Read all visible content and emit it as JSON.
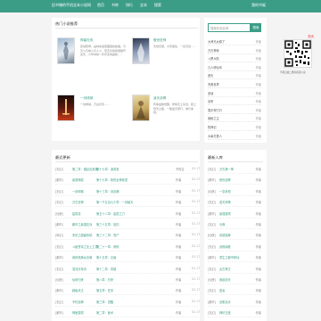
{
  "header": {
    "site_name": "旧书铺的手机全本小说网",
    "nav": [
      "首页",
      "书库",
      "排行",
      "全本",
      "搜索"
    ],
    "bookshelf": "我的书架"
  },
  "featured": {
    "title": "热门小说推荐",
    "books": [
      {
        "title": "神墓无双",
        "desc": "武动乾坤，是林动发奋图强的故事。与天斗与地斗与人斗，苍天负我我便破开这天，少年林动一步步走向巅峰……"
      },
      {
        "title": "傲世狂神",
        "desc": "天地无量，大帝诞生，一念灭世……"
      },
      {
        "title": "一剑倾城",
        "desc": "一剑倾城，万古长存……"
      },
      {
        "title": "凌天战尊",
        "desc": "传承血脉觉醒，修炼无上功法，踏上登天之路，一路逆天而行，谁与争锋。"
      }
    ]
  },
  "search": {
    "placeholder": "搜索作品名称",
    "button": "搜索"
  },
  "ranking": {
    "items": [
      {
        "title": "大师兄太稳了",
        "author": "作者"
      },
      {
        "title": "万古神帝",
        "author": "作者"
      },
      {
        "title": "斗罗大陆",
        "author": "作者"
      },
      {
        "title": "凡人修仙传",
        "author": "作者"
      },
      {
        "title": "遮天",
        "author": "作者"
      },
      {
        "title": "完美世界",
        "author": "作者"
      },
      {
        "title": "圣墟",
        "author": "作者"
      },
      {
        "title": "剑来",
        "author": "作者"
      },
      {
        "title": "雪中悍刀行",
        "author": "作者"
      },
      {
        "title": "诡秘之主",
        "author": "作者"
      },
      {
        "title": "牧神记",
        "author": "作者"
      },
      {
        "title": "大奉打更人",
        "author": "作者"
      }
    ]
  },
  "latest": {
    "title": "最近更新",
    "rows": [
      {
        "cat": "[玄幻]",
        "name": "第二章：被赶出家族",
        "chapter": "第十七章：凌霄宫",
        "author": "不知名",
        "date": "02-17"
      },
      {
        "cat": "[都市]",
        "name": "最强神豪",
        "chapter": "第十七章：我的女神老婆",
        "author": "作者",
        "date": "02-17"
      },
      {
        "cat": "[玄幻]",
        "name": "一剑倾城",
        "chapter": "第十三章：剑出鞘",
        "author": "作者",
        "date": "02-17"
      },
      {
        "cat": "[玄幻]",
        "name": "万古狂神",
        "chapter": "第一千五百九十章：一剑破天",
        "author": "作者",
        "date": "02-17"
      },
      {
        "cat": "[仙侠]",
        "name": "星辰变",
        "chapter": "第五十八章：星辰之力",
        "author": "作者",
        "date": "02-17"
      },
      {
        "cat": "[都市]",
        "name": "都市之最强狂兵",
        "chapter": "第三十五章：回归",
        "author": "作者",
        "date": "02-17"
      },
      {
        "cat": "[科幻]",
        "name": "末世之超级系统",
        "chapter": "第三十二章：丧尸",
        "author": "作者",
        "date": "02-17"
      },
      {
        "cat": "[玄幻]",
        "name": "斗破苍穹之无上之境",
        "chapter": "第二十一章：修炼",
        "author": "作者",
        "date": "02-17"
      },
      {
        "cat": "[都市]",
        "name": "我的绝美女总裁",
        "chapter": "第十五章：见面",
        "author": "作者",
        "date": "02-17"
      },
      {
        "cat": "[玄幻]",
        "name": "混沌天帝诀",
        "chapter": "第十二章：突破",
        "author": "作者",
        "date": "02-17"
      },
      {
        "cat": "[仙侠]",
        "name": "仙帝归来",
        "chapter": "第八章：归来",
        "author": "作者",
        "date": "02-17"
      },
      {
        "cat": "[都市]",
        "name": "超级兵王",
        "chapter": "第五章：任务",
        "author": "作者",
        "date": "02-17"
      },
      {
        "cat": "[玄幻]",
        "name": "不朽战神",
        "chapter": "第三章：觉醒",
        "author": "作者",
        "date": "02-17"
      },
      {
        "cat": "[都市]",
        "name": "神医赘婿",
        "chapter": "第二章：医术",
        "author": "作者",
        "date": "02-17"
      }
    ]
  },
  "newbooks": {
    "title": "最新入库",
    "rows": [
      {
        "cat": "[玄幻]",
        "name": "万古第一神",
        "author": "作者"
      },
      {
        "cat": "[都市]",
        "name": "绝世战神",
        "author": "作者"
      },
      {
        "cat": "[仙侠]",
        "name": "一念永恒",
        "author": "作者"
      },
      {
        "cat": "[玄幻]",
        "name": "逆天邪神",
        "author": "作者"
      },
      {
        "cat": "[都市]",
        "name": "最强赘婿",
        "author": "作者"
      },
      {
        "cat": "[玄幻]",
        "name": "元尊",
        "author": "作者"
      },
      {
        "cat": "[仙侠]",
        "name": "剑道独尊",
        "author": "作者"
      },
      {
        "cat": "[玄幻]",
        "name": "武炼巅峰",
        "author": "作者"
      },
      {
        "cat": "[都市]",
        "name": "重生之都市修仙",
        "author": "作者"
      },
      {
        "cat": "[玄幻]",
        "name": "太古神王",
        "author": "作者"
      },
      {
        "cat": "[仙侠]",
        "name": "我欲封天",
        "author": "作者"
      },
      {
        "cat": "[玄幻]",
        "name": "盘龙",
        "author": "作者"
      },
      {
        "cat": "[都市]",
        "name": "全职高手",
        "author": "作者"
      },
      {
        "cat": "[玄幻]",
        "name": "神印王座",
        "author": "作者"
      }
    ]
  },
  "qr": {
    "close": "关闭",
    "caption": "手机扫描二维码阅读小说"
  },
  "colors": {
    "accent": "#3c9d86"
  }
}
